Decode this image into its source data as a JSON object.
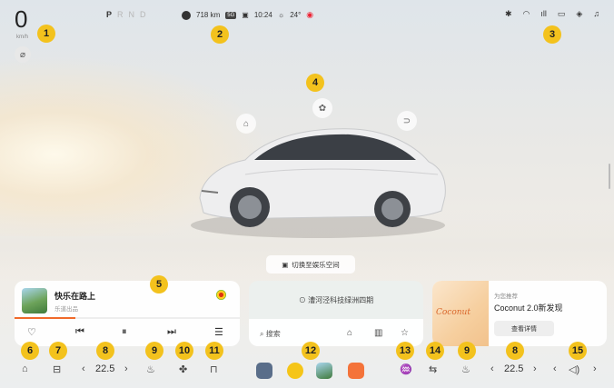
{
  "status": {
    "speed": "0",
    "speed_unit": "km/h",
    "gears": [
      "P",
      "R",
      "N",
      "D"
    ],
    "active_gear": "P",
    "range": "718 km",
    "tag": "5G",
    "time": "10:24",
    "weather": "24°"
  },
  "car_functions": [
    "lock-icon",
    "wiper-icon",
    "trunk-icon"
  ],
  "switch_space": {
    "label": "切换至娱乐空间"
  },
  "music": {
    "song": "快乐在路上",
    "artist": "乐道出品",
    "progress": 0.27
  },
  "nav": {
    "destination": "漕河泾科技绿洲四期",
    "search_placeholder": "搜索"
  },
  "promo": {
    "logo": "Coconut",
    "subtitle": "为您推荐",
    "title": "Coconut 2.0新发现",
    "button": "查看详情"
  },
  "dock": {
    "left_temp": "22.5",
    "right_temp": "22.5"
  },
  "badges": [
    "1",
    "2",
    "3",
    "4",
    "5",
    "6",
    "7",
    "8",
    "9",
    "10",
    "11",
    "12",
    "13",
    "14",
    "9",
    "8",
    "15"
  ],
  "colors": {
    "accent": "#f3c21d",
    "progress": "#f06a2a"
  }
}
